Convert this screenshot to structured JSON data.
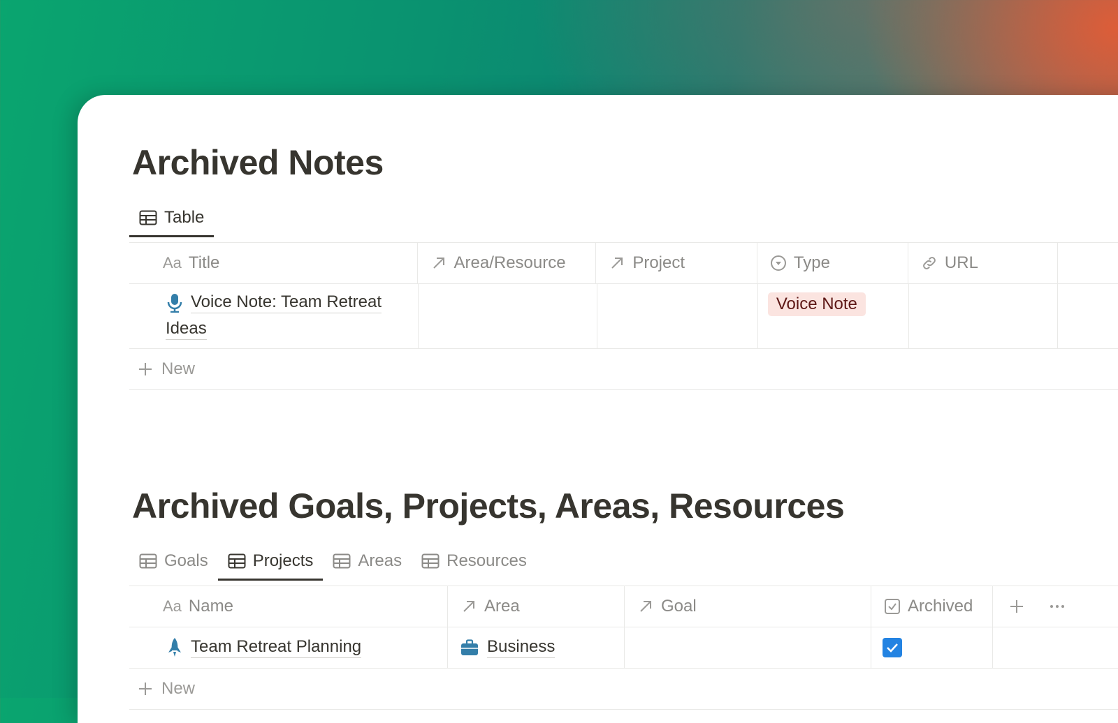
{
  "notes_section": {
    "title": "Archived Notes",
    "view_tab": {
      "label": "Table",
      "icon": "table-icon"
    },
    "columns": [
      {
        "label": "Title",
        "prefix": "Aa",
        "icon": "text-aa-icon"
      },
      {
        "label": "Area/Resource",
        "icon": "relation-arrow-icon"
      },
      {
        "label": "Project",
        "icon": "relation-arrow-icon"
      },
      {
        "label": "Type",
        "icon": "select-icon"
      },
      {
        "label": "URL",
        "icon": "link-icon"
      }
    ],
    "rows": [
      {
        "title_line1": "Voice Note: Team Retreat",
        "title_line2": "Ideas",
        "icon": "microphone-icon",
        "type": "Voice Note",
        "type_color": "#fbe4e0"
      }
    ],
    "new_label": "New"
  },
  "archive_section": {
    "title": "Archived Goals, Projects, Areas, Resources",
    "tabs": [
      {
        "label": "Goals",
        "active": false
      },
      {
        "label": "Projects",
        "active": true
      },
      {
        "label": "Areas",
        "active": false
      },
      {
        "label": "Resources",
        "active": false
      }
    ],
    "columns": [
      {
        "label": "Name",
        "prefix": "Aa"
      },
      {
        "label": "Area"
      },
      {
        "label": "Goal"
      },
      {
        "label": "Archived"
      }
    ],
    "rows": [
      {
        "name": "Team Retreat Planning",
        "icon": "rocket-icon",
        "area": "Business",
        "area_icon": "briefcase-icon",
        "archived": true
      }
    ],
    "new_label": "New",
    "accent": "#2383e2"
  }
}
